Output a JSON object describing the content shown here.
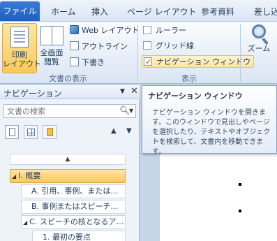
{
  "ribbon": {
    "tabs": [
      {
        "label": "ファイル",
        "active": true
      },
      {
        "label": "ホーム"
      },
      {
        "label": "挿入"
      },
      {
        "label": "ページ レイアウト"
      },
      {
        "label": "参考資料"
      },
      {
        "label": "差し込"
      }
    ],
    "view_group": {
      "label": "文書の表示",
      "print_layout": "印刷\nレイアウト",
      "print_layout_line1": "印刷",
      "print_layout_line2": "レイアウト",
      "full_screen_line1": "全画面",
      "full_screen_line2": "閲覧",
      "web_layout": "Web レイアウト",
      "outline": "アウトライン",
      "draft": "下書き"
    },
    "show_group": {
      "label": "表示",
      "ruler": {
        "label": "ルーラー",
        "checked": false
      },
      "gridlines": {
        "label": "グリッド線",
        "checked": false
      },
      "nav_pane": {
        "label": "ナビゲーション ウィンドウ",
        "checked": true
      }
    },
    "zoom_label": "ズーム"
  },
  "navpane": {
    "title": "ナビゲーション",
    "search_placeholder": "文書の検索",
    "outline": [
      {
        "label": "I. 概要",
        "level": 0,
        "selected": true,
        "expanded": true
      },
      {
        "label": "A. 引用、事例、または…",
        "level": 1
      },
      {
        "label": "B. 事例またはスピーチの…",
        "level": 1
      },
      {
        "label": "C. スピーチの核となるア…",
        "level": 1,
        "expanded": true
      },
      {
        "label": "1. 最初の要点",
        "level": 2
      }
    ]
  },
  "tooltip": {
    "title": "ナビゲーション ウィンドウ",
    "body": "ナビゲーション ウィンドウを開きます。このウィンドウで見出しやページを選択したり、テキストやオブジェクトを検索して、文書内を移動できます。"
  },
  "colors": {
    "file_tab": "#1f5fbf",
    "highlight": "#f9c95a",
    "nav_bg": "#eef3fa"
  }
}
